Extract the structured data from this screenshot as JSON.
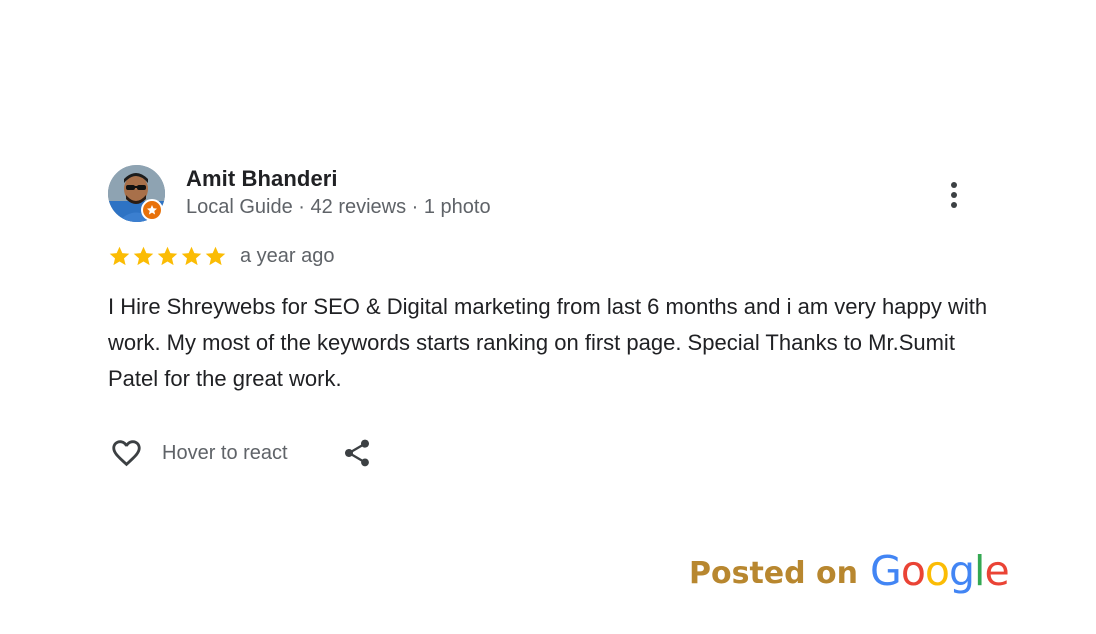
{
  "reviewer": {
    "name": "Amit Bhanderi",
    "meta": "Local Guide · 42 reviews · 1 photo"
  },
  "rating": {
    "stars": 5,
    "max": 5,
    "time": "a year ago"
  },
  "review": {
    "text": "I Hire Shreywebs for SEO & Digital marketing from last 6 months and i am very happy with work. My most of the keywords starts ranking on first page. Special Thanks to Mr.Sumit Patel for the great work."
  },
  "actions": {
    "react_label": "Hover to react"
  },
  "footer": {
    "posted_label": "Posted on",
    "brand_letters": [
      "G",
      "o",
      "o",
      "g",
      "l",
      "e"
    ]
  },
  "colors": {
    "star": "#fbbc04",
    "posted_label": "#b8872f",
    "badge": "#e8710a",
    "google_blue": "#4285f4",
    "google_red": "#ea4335",
    "google_yellow": "#fbbc05",
    "google_green": "#34a853"
  },
  "icons": {
    "more": "more-vert-icon",
    "react": "heart-outline-icon",
    "share": "share-icon",
    "badge": "local-guide-star-icon",
    "star": "star-icon"
  }
}
